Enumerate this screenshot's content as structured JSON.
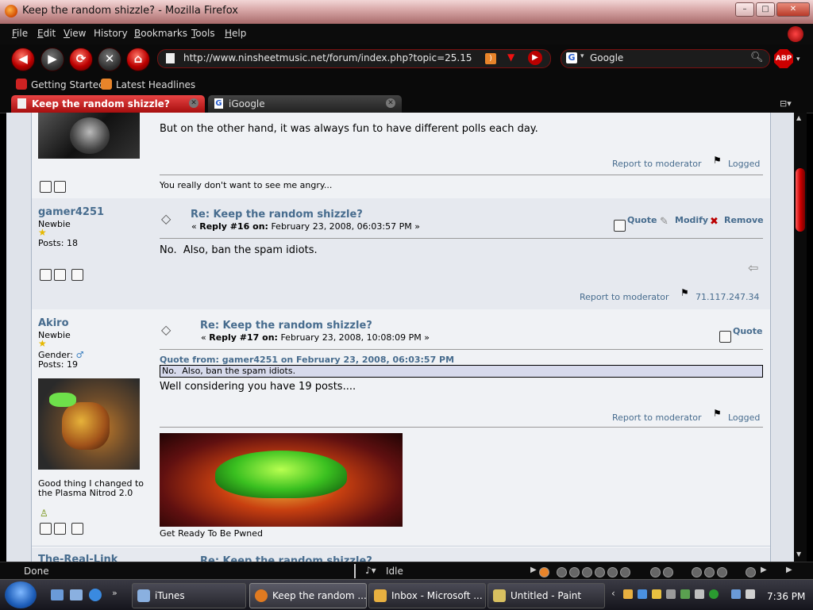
{
  "window": {
    "title": "Keep the random shizzle? - Mozilla Firefox"
  },
  "menu": [
    {
      "key": "F",
      "rest": "ile"
    },
    {
      "key": "E",
      "rest": "dit"
    },
    {
      "key": "V",
      "rest": "iew"
    },
    {
      "key": "",
      "rest": "History"
    },
    {
      "key": "B",
      "rest": "ookmarks"
    },
    {
      "key": "T",
      "rest": "ools"
    },
    {
      "key": "H",
      "rest": "elp"
    }
  ],
  "address": {
    "url": "http://www.ninsheetmusic.net/forum/index.php?topic=25.15"
  },
  "search": {
    "engine": "Google"
  },
  "bookmarks": [
    "Getting Started",
    "Latest Headlines"
  ],
  "tabs": [
    {
      "label": "Keep the random shizzle?",
      "active": true
    },
    {
      "label": "iGoogle",
      "active": false
    }
  ],
  "posts": {
    "p15": {
      "body": "But on the other hand, it was always fun to have different polls each day.",
      "report": "Report to moderator",
      "logged": "Logged",
      "signature": "You really don't want to see me angry..."
    },
    "p16": {
      "user": "gamer4251",
      "rank": "Newbie",
      "posts_count": "Posts: 18",
      "subject": "Re: Keep the random shizzle?",
      "reply_label": "Reply #16 on:",
      "date": "February 23, 2008, 06:03:57 PM",
      "quote": "Quote",
      "modify": "Modify",
      "remove": "Remove",
      "body": "No.  Also, ban the spam idiots.",
      "report": "Report to moderator",
      "ip": "71.117.247.34"
    },
    "p17": {
      "user": "Akiro",
      "rank": "Newbie",
      "gender_label": "Gender:",
      "posts_count": "Posts: 19",
      "personal_text": "Good thing I changed to the Plasma Nitrod 2.0",
      "subject": "Re: Keep the random shizzle?",
      "reply_label": "Reply #17 on:",
      "date": "February 23, 2008, 10:08:09 PM",
      "quote": "Quote",
      "quote_header": "Quote from: gamer4251 on February 23, 2008, 06:03:57 PM",
      "quote_body": "No.  Also, ban the spam idiots.",
      "body": "Well considering you have 19 posts....",
      "report": "Report to moderator",
      "logged": "Logged",
      "signature_caption": "Get Ready To Be Pwned"
    },
    "p18": {
      "user": "The-Real-Link",
      "subject": "Re: Keep the random shizzle?"
    }
  },
  "status": {
    "left": "Done",
    "player": "Idle"
  },
  "taskbar": {
    "items": [
      "iTunes",
      "Keep the random ...",
      "Inbox - Microsoft ...",
      "Untitled - Paint"
    ],
    "clock": "7:36 PM"
  },
  "colors": {
    "accent": "#cc0000",
    "link": "#476c8e",
    "title_bar": "#d9a9a9"
  }
}
